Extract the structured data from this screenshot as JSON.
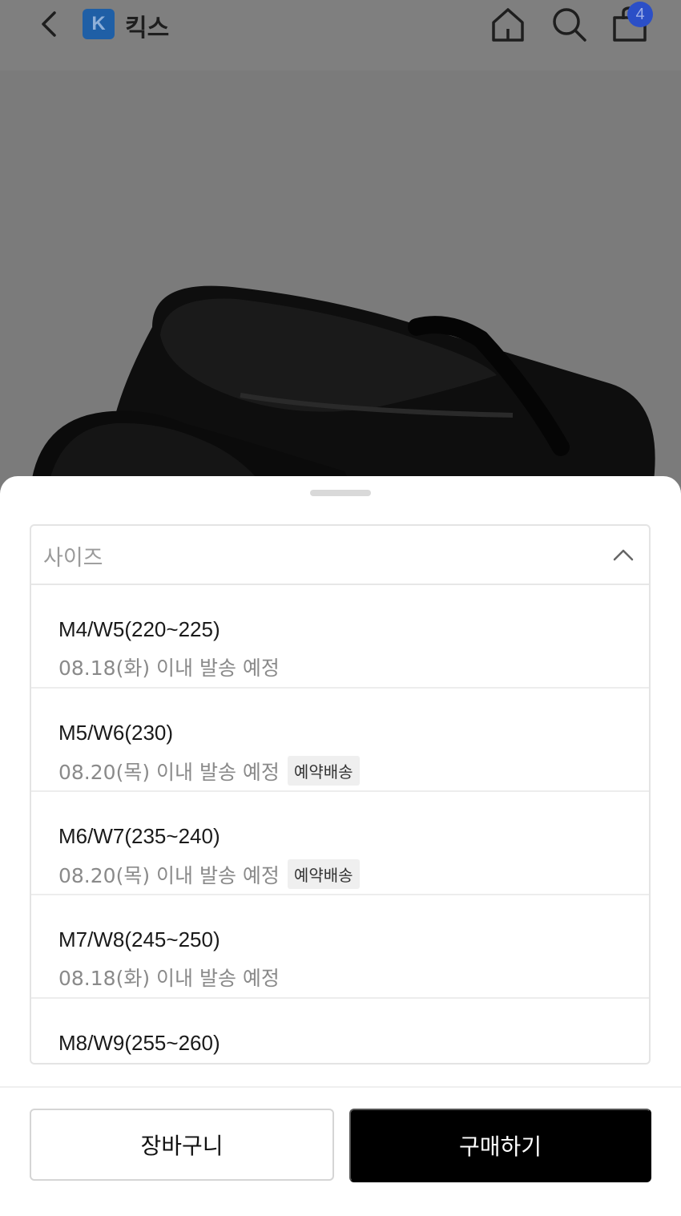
{
  "header": {
    "brand_logo_letter": "K",
    "brand_name": "킥스",
    "cart_count": "4",
    "icons": [
      "back-icon",
      "home-icon",
      "search-icon",
      "bag-icon"
    ]
  },
  "option_sheet": {
    "select_label": "사이즈",
    "options": [
      {
        "size": "M4/W5(220~225)",
        "shipping": "08.18(화) 이내 발송 예정",
        "tag": ""
      },
      {
        "size": "M5/W6(230)",
        "shipping": "08.20(목) 이내 발송 예정",
        "tag": "예약배송"
      },
      {
        "size": "M6/W7(235~240)",
        "shipping": "08.20(목) 이내 발송 예정",
        "tag": "예약배송"
      },
      {
        "size": "M7/W8(245~250)",
        "shipping": "08.18(화) 이내 발송 예정",
        "tag": ""
      },
      {
        "size": "M8/W9(255~260)",
        "shipping": "",
        "tag": ""
      }
    ]
  },
  "actions": {
    "cart_label": "장바구니",
    "buy_label": "구매하기"
  },
  "colors": {
    "overlay": "#7c7c7c",
    "badge": "#2b4fc7",
    "logo": "#1f5fa6",
    "buy_button": "#000000"
  }
}
